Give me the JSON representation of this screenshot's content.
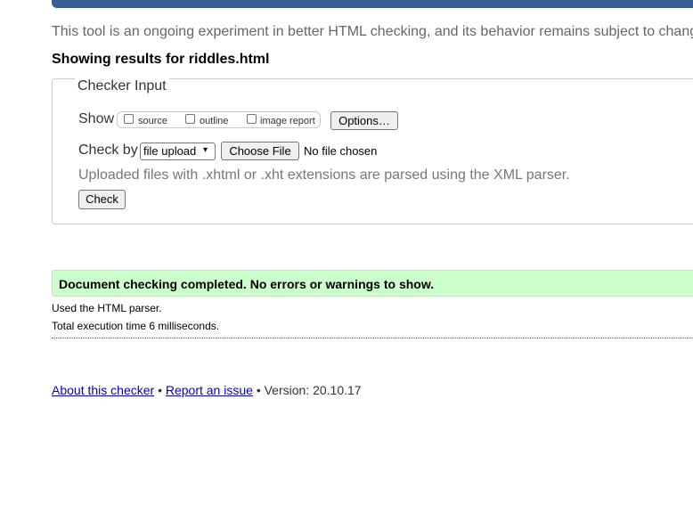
{
  "intro_text": "This tool is an ongoing experiment in better HTML checking, and its behavior remains subject to chang",
  "results_heading": "Showing results for riddles.html",
  "checker_input": {
    "legend": "Checker Input",
    "show_label": "Show",
    "options": [
      {
        "label": "source",
        "checked": false
      },
      {
        "label": "outline",
        "checked": false
      },
      {
        "label": "image report",
        "checked": false
      }
    ],
    "options_button": "Options…",
    "check_by_label": "Check by",
    "check_by_value": "file upload",
    "choose_file_button": "Choose File",
    "no_file_text": "No file chosen",
    "xml_note": "Uploaded files with .xhtml or .xht extensions are parsed using the XML parser.",
    "check_button": "Check"
  },
  "result": {
    "message": "Document checking completed. No errors or warnings to show.",
    "parser_info": "Used the HTML parser.",
    "execution_time": "Total execution time 6 milliseconds."
  },
  "footer": {
    "about_link": "About this checker",
    "separator": "•",
    "report_link": "Report an issue",
    "version_text": "Version: 20.10.17"
  },
  "colors": {
    "top_bar": "#365d95",
    "success_bg": "#ccffcc",
    "link": "#0000cc"
  }
}
